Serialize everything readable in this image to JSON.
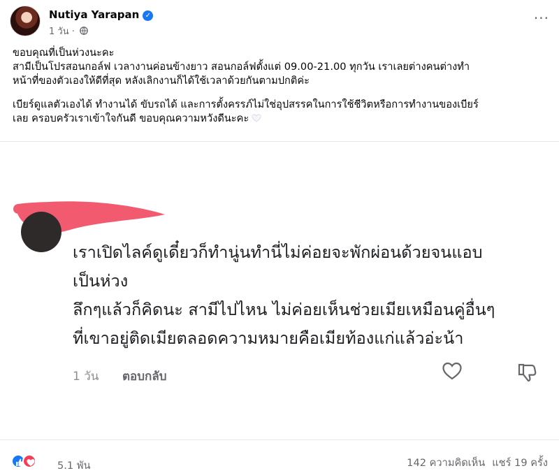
{
  "post": {
    "author": "Nutiya Yarapan",
    "time": "1 วัน",
    "privacy_separator": "·",
    "more_label": "···"
  },
  "caption": {
    "paragraph1": "ขอบคุณที่เป็นห่วงนะคะ\nสามีเป็นโปรสอนกอล์ฟ เวลางานค่อนข้างยาว สอนกอล์ฟตั้งแต่ 09.00-21.00 ทุกวัน เราเลยต่างคนต่างทำ\nหน้าที่ของตัวเองให้ดีที่สุด หลังเลิกงานก็ได้ใช้เวลาด้วยกันตามปกติค่ะ",
    "paragraph2": "เบียร์ดูแลตัวเองได้ ทำงานได้ ขับรถได้ และการตั้งครรภ์ไม่ใช่อุปสรรคในการใช้ชีวิตหรือการทำงานของเบียร์\nเลย ครอบครัวเราเข้าใจกันดี ขอบคุณความหวังดีนะคะ"
  },
  "screenshot_comment": {
    "text": "เราเปิดไลค์ดูเดี๋ยวก็ทำนู่นทำนี่ไม่ค่อยจะพักผ่อนด้วยจนแอบ\nเป็นห่วง\nลึกๆแล้วก็คิดนะ สามีไปไหน ไม่ค่อยเห็นช่วยเมียเหมือนคู่อื่นๆ\nที่เขาอยู่ติดเมียตลอดความหมายคือเมียท้องแก่แล้วอ่ะน้า",
    "time": "1 วัน",
    "reply_label": "ตอบกลับ",
    "redaction_color": "#f25a6f"
  },
  "footer": {
    "reaction_count": "5.1 พัน",
    "comments": "142 ความคิดเห็น",
    "shares": "แชร์ 19 ครั้ง"
  },
  "colors": {
    "accent": "#1877f2",
    "love": "#f33e58",
    "secondary_text": "#65676b"
  },
  "icons": [
    "verified-badge-icon",
    "globe-icon",
    "more-icon",
    "white-heart-emoji",
    "like-outline-icon",
    "dislike-outline-icon",
    "like-reaction-icon",
    "love-reaction-icon"
  ]
}
